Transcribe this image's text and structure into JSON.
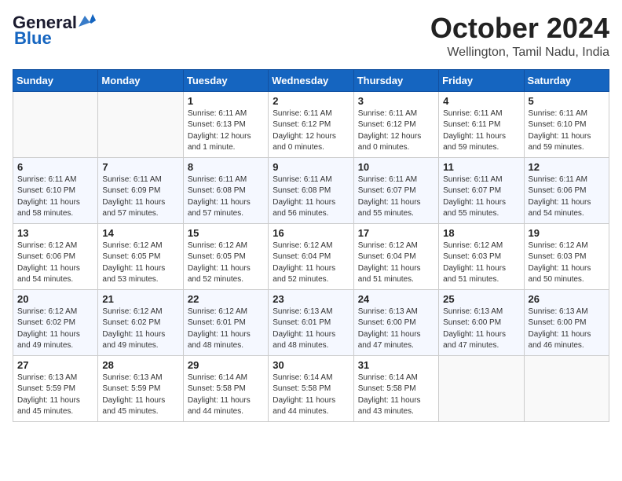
{
  "logo": {
    "line1": "General",
    "line2": "Blue",
    "icon_color": "#1565c0"
  },
  "title": "October 2024",
  "location": "Wellington, Tamil Nadu, India",
  "days_of_week": [
    "Sunday",
    "Monday",
    "Tuesday",
    "Wednesday",
    "Thursday",
    "Friday",
    "Saturday"
  ],
  "weeks": [
    [
      {
        "day": "",
        "info": ""
      },
      {
        "day": "",
        "info": ""
      },
      {
        "day": "1",
        "info": "Sunrise: 6:11 AM\nSunset: 6:13 PM\nDaylight: 12 hours\nand 1 minute."
      },
      {
        "day": "2",
        "info": "Sunrise: 6:11 AM\nSunset: 6:12 PM\nDaylight: 12 hours\nand 0 minutes."
      },
      {
        "day": "3",
        "info": "Sunrise: 6:11 AM\nSunset: 6:12 PM\nDaylight: 12 hours\nand 0 minutes."
      },
      {
        "day": "4",
        "info": "Sunrise: 6:11 AM\nSunset: 6:11 PM\nDaylight: 11 hours\nand 59 minutes."
      },
      {
        "day": "5",
        "info": "Sunrise: 6:11 AM\nSunset: 6:10 PM\nDaylight: 11 hours\nand 59 minutes."
      }
    ],
    [
      {
        "day": "6",
        "info": "Sunrise: 6:11 AM\nSunset: 6:10 PM\nDaylight: 11 hours\nand 58 minutes."
      },
      {
        "day": "7",
        "info": "Sunrise: 6:11 AM\nSunset: 6:09 PM\nDaylight: 11 hours\nand 57 minutes."
      },
      {
        "day": "8",
        "info": "Sunrise: 6:11 AM\nSunset: 6:08 PM\nDaylight: 11 hours\nand 57 minutes."
      },
      {
        "day": "9",
        "info": "Sunrise: 6:11 AM\nSunset: 6:08 PM\nDaylight: 11 hours\nand 56 minutes."
      },
      {
        "day": "10",
        "info": "Sunrise: 6:11 AM\nSunset: 6:07 PM\nDaylight: 11 hours\nand 55 minutes."
      },
      {
        "day": "11",
        "info": "Sunrise: 6:11 AM\nSunset: 6:07 PM\nDaylight: 11 hours\nand 55 minutes."
      },
      {
        "day": "12",
        "info": "Sunrise: 6:11 AM\nSunset: 6:06 PM\nDaylight: 11 hours\nand 54 minutes."
      }
    ],
    [
      {
        "day": "13",
        "info": "Sunrise: 6:12 AM\nSunset: 6:06 PM\nDaylight: 11 hours\nand 54 minutes."
      },
      {
        "day": "14",
        "info": "Sunrise: 6:12 AM\nSunset: 6:05 PM\nDaylight: 11 hours\nand 53 minutes."
      },
      {
        "day": "15",
        "info": "Sunrise: 6:12 AM\nSunset: 6:05 PM\nDaylight: 11 hours\nand 52 minutes."
      },
      {
        "day": "16",
        "info": "Sunrise: 6:12 AM\nSunset: 6:04 PM\nDaylight: 11 hours\nand 52 minutes."
      },
      {
        "day": "17",
        "info": "Sunrise: 6:12 AM\nSunset: 6:04 PM\nDaylight: 11 hours\nand 51 minutes."
      },
      {
        "day": "18",
        "info": "Sunrise: 6:12 AM\nSunset: 6:03 PM\nDaylight: 11 hours\nand 51 minutes."
      },
      {
        "day": "19",
        "info": "Sunrise: 6:12 AM\nSunset: 6:03 PM\nDaylight: 11 hours\nand 50 minutes."
      }
    ],
    [
      {
        "day": "20",
        "info": "Sunrise: 6:12 AM\nSunset: 6:02 PM\nDaylight: 11 hours\nand 49 minutes."
      },
      {
        "day": "21",
        "info": "Sunrise: 6:12 AM\nSunset: 6:02 PM\nDaylight: 11 hours\nand 49 minutes."
      },
      {
        "day": "22",
        "info": "Sunrise: 6:12 AM\nSunset: 6:01 PM\nDaylight: 11 hours\nand 48 minutes."
      },
      {
        "day": "23",
        "info": "Sunrise: 6:13 AM\nSunset: 6:01 PM\nDaylight: 11 hours\nand 48 minutes."
      },
      {
        "day": "24",
        "info": "Sunrise: 6:13 AM\nSunset: 6:00 PM\nDaylight: 11 hours\nand 47 minutes."
      },
      {
        "day": "25",
        "info": "Sunrise: 6:13 AM\nSunset: 6:00 PM\nDaylight: 11 hours\nand 47 minutes."
      },
      {
        "day": "26",
        "info": "Sunrise: 6:13 AM\nSunset: 6:00 PM\nDaylight: 11 hours\nand 46 minutes."
      }
    ],
    [
      {
        "day": "27",
        "info": "Sunrise: 6:13 AM\nSunset: 5:59 PM\nDaylight: 11 hours\nand 45 minutes."
      },
      {
        "day": "28",
        "info": "Sunrise: 6:13 AM\nSunset: 5:59 PM\nDaylight: 11 hours\nand 45 minutes."
      },
      {
        "day": "29",
        "info": "Sunrise: 6:14 AM\nSunset: 5:58 PM\nDaylight: 11 hours\nand 44 minutes."
      },
      {
        "day": "30",
        "info": "Sunrise: 6:14 AM\nSunset: 5:58 PM\nDaylight: 11 hours\nand 44 minutes."
      },
      {
        "day": "31",
        "info": "Sunrise: 6:14 AM\nSunset: 5:58 PM\nDaylight: 11 hours\nand 43 minutes."
      },
      {
        "day": "",
        "info": ""
      },
      {
        "day": "",
        "info": ""
      }
    ]
  ]
}
